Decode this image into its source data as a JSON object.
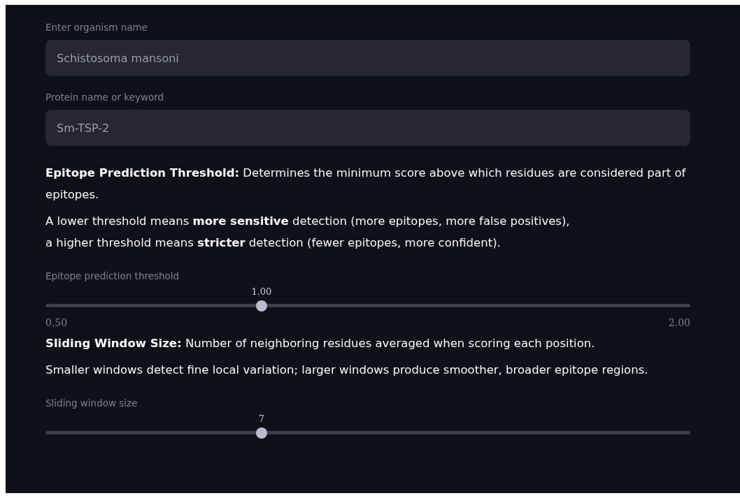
{
  "fields": [
    {
      "label": "Enter organism name",
      "value": "Schistosoma mansoni",
      "disabled": true
    },
    {
      "label": "Protein name or keyword",
      "value": "Sm-TSP-2",
      "disabled": true
    }
  ],
  "sections": [
    {
      "lines": [
        "**Epitope Prediction Threshold:** Determines the minimum score above which residues are considered part of epitopes.",
        "A lower threshold means **more sensitive** detection (more epitopes, more false positives),",
        "a higher threshold means **stricter** detection (fewer epitopes, more confident)."
      ],
      "slider": {
        "label": "Epitope prediction threshold",
        "reading": "1.00",
        "level": 0.335,
        "min": "0.50",
        "max": "2.00"
      }
    },
    {
      "lines": [
        "**Sliding Window Size:** Number of neighboring residues averaged when scoring each position.",
        "Smaller windows detect fine local variation; larger windows produce smoother, broader epitope regions."
      ],
      "slider": {
        "label": "Sliding window size",
        "reading": "7",
        "level": 0.335
      }
    }
  ]
}
